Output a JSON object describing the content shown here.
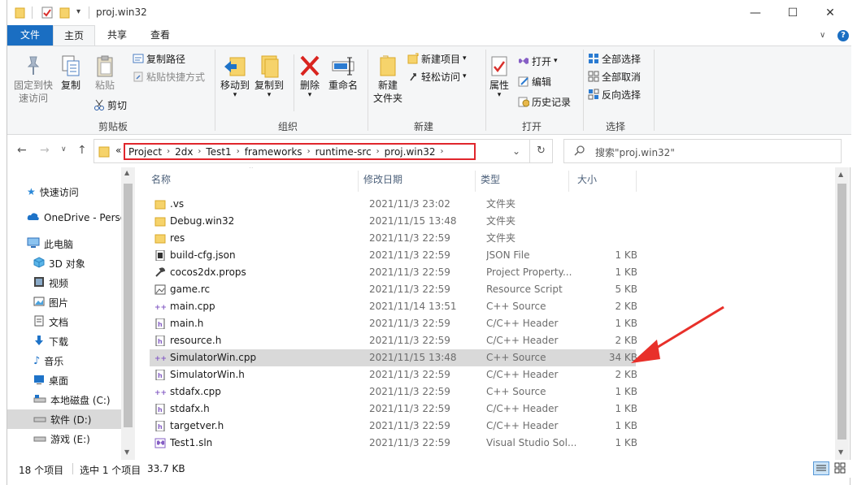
{
  "window": {
    "title": "proj.win32",
    "controls": {
      "minimize": "—",
      "maximize": "☐",
      "close": "✕"
    }
  },
  "tabs": [
    "文件",
    "主页",
    "共享",
    "查看"
  ],
  "ribbon": {
    "clipboard": {
      "pin": "固定到快\n速访问",
      "copy": "复制",
      "paste": "粘贴",
      "copy_path": "复制路径",
      "paste_shortcut": "粘贴快捷方式",
      "cut": "剪切",
      "label": "剪贴板"
    },
    "organize": {
      "move_to": "移动到",
      "copy_to": "复制到",
      "delete": "删除",
      "rename": "重命名",
      "label": "组织"
    },
    "new": {
      "new_folder": "新建\n文件夹",
      "new_item": "新建项目",
      "easy_access": "轻松访问",
      "label": "新建"
    },
    "open": {
      "properties": "属性",
      "open": "打开",
      "edit": "编辑",
      "history": "历史记录",
      "label": "打开"
    },
    "select": {
      "select_all": "全部选择",
      "select_none": "全部取消",
      "invert": "反向选择",
      "label": "选择"
    }
  },
  "address": {
    "overflow": "«",
    "breadcrumbs": [
      "Project",
      "2dx",
      "Test1",
      "frameworks",
      "runtime-src",
      "proj.win32"
    ],
    "search_placeholder": "搜索\"proj.win32\""
  },
  "nav": {
    "items": [
      {
        "label": "快速访问",
        "icon": "star-icon",
        "color": "#2b88d8"
      },
      {
        "label": "OneDrive - Perso",
        "icon": "cloud-icon",
        "color": "#1e73c8"
      },
      {
        "label": "此电脑",
        "icon": "computer-icon",
        "color": "#3a7bd5"
      },
      {
        "label": "3D 对象",
        "icon": "cube-icon",
        "color": "#4aa3df"
      },
      {
        "label": "视频",
        "icon": "video-icon",
        "color": "#555555"
      },
      {
        "label": "图片",
        "icon": "picture-icon",
        "color": "#555555"
      },
      {
        "label": "文档",
        "icon": "document-icon",
        "color": "#555555"
      },
      {
        "label": "下载",
        "icon": "download-icon",
        "color": "#1e73c8"
      },
      {
        "label": "音乐",
        "icon": "music-icon",
        "color": "#1e73c8"
      },
      {
        "label": "桌面",
        "icon": "desktop-icon",
        "color": "#1e73c8"
      },
      {
        "label": "本地磁盘 (C:)",
        "icon": "drive-icon",
        "color": "#666666"
      },
      {
        "label": "软件 (D:)",
        "icon": "drive-icon",
        "color": "#666666"
      },
      {
        "label": "游戏 (E:)",
        "icon": "drive-icon",
        "color": "#666666"
      }
    ]
  },
  "columns": {
    "name": "名称",
    "date": "修改日期",
    "type": "类型",
    "size": "大小"
  },
  "files": [
    {
      "name": ".vs",
      "date": "2021/11/3 23:02",
      "type": "文件夹",
      "size": "",
      "icon": "folder-icon"
    },
    {
      "name": "Debug.win32",
      "date": "2021/11/15 13:48",
      "type": "文件夹",
      "size": "",
      "icon": "folder-icon"
    },
    {
      "name": "res",
      "date": "2021/11/3 22:59",
      "type": "文件夹",
      "size": "",
      "icon": "folder-icon"
    },
    {
      "name": "build-cfg.json",
      "date": "2021/11/3 22:59",
      "type": "JSON File",
      "size": "1 KB",
      "icon": "json-file-icon"
    },
    {
      "name": "cocos2dx.props",
      "date": "2021/11/3 22:59",
      "type": "Project Property...",
      "size": "1 KB",
      "icon": "wrench-icon"
    },
    {
      "name": "game.rc",
      "date": "2021/11/3 22:59",
      "type": "Resource Script",
      "size": "5 KB",
      "icon": "resource-file-icon"
    },
    {
      "name": "main.cpp",
      "date": "2021/11/14 13:51",
      "type": "C++ Source",
      "size": "2 KB",
      "icon": "cpp-file-icon"
    },
    {
      "name": "main.h",
      "date": "2021/11/3 22:59",
      "type": "C/C++ Header",
      "size": "1 KB",
      "icon": "header-file-icon"
    },
    {
      "name": "resource.h",
      "date": "2021/11/3 22:59",
      "type": "C/C++ Header",
      "size": "2 KB",
      "icon": "header-file-icon"
    },
    {
      "name": "SimulatorWin.cpp",
      "date": "2021/11/15 13:48",
      "type": "C++ Source",
      "size": "34 KB",
      "icon": "cpp-file-icon"
    },
    {
      "name": "SimulatorWin.h",
      "date": "2021/11/3 22:59",
      "type": "C/C++ Header",
      "size": "2 KB",
      "icon": "header-file-icon"
    },
    {
      "name": "stdafx.cpp",
      "date": "2021/11/3 22:59",
      "type": "C++ Source",
      "size": "1 KB",
      "icon": "cpp-file-icon"
    },
    {
      "name": "stdafx.h",
      "date": "2021/11/3 22:59",
      "type": "C/C++ Header",
      "size": "1 KB",
      "icon": "header-file-icon"
    },
    {
      "name": "targetver.h",
      "date": "2021/11/3 22:59",
      "type": "C/C++ Header",
      "size": "1 KB",
      "icon": "header-file-icon"
    },
    {
      "name": "Test1.sln",
      "date": "2021/11/3 22:59",
      "type": "Visual Studio Sol...",
      "size": "1 KB",
      "icon": "solution-file-icon"
    }
  ],
  "selected_file": "SimulatorWin.cpp",
  "status": {
    "count": "18 个项目",
    "selection": "选中 1 个项目",
    "size": "33.7 KB"
  },
  "colors": {
    "accent": "#1a6ec2",
    "highlight_box": "#e0262c",
    "annotation_arrow": "#e8302a",
    "selection": "#d9d9d9"
  }
}
